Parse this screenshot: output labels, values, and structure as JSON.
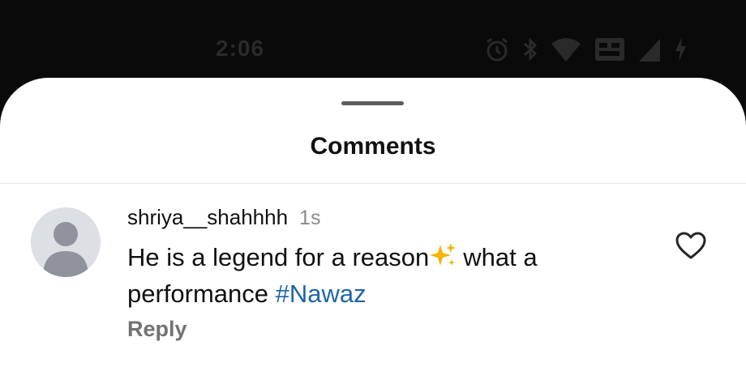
{
  "status_bar": {
    "time": "2:06",
    "icons": [
      "alarm-icon",
      "bluetooth-icon",
      "wifi-icon",
      "volte-icon",
      "signal-icon",
      "battery-charging-icon"
    ]
  },
  "sheet": {
    "title": "Comments"
  },
  "comments": [
    {
      "username": "shriya__shahhhh",
      "time_ago": "1s",
      "text_part1": "He is a legend for a reason",
      "emoji": "sparkles-icon",
      "text_part2": "what a performance",
      "hashtag": "#Nawaz",
      "reply_label": "Reply",
      "like_icon": "heart-outline-icon"
    }
  ],
  "colors": {
    "hashtag": "#1f65a8",
    "status_bar_bg": "#0a0a0a",
    "sheet_bg": "#ffffff",
    "muted_text": "#737373"
  }
}
